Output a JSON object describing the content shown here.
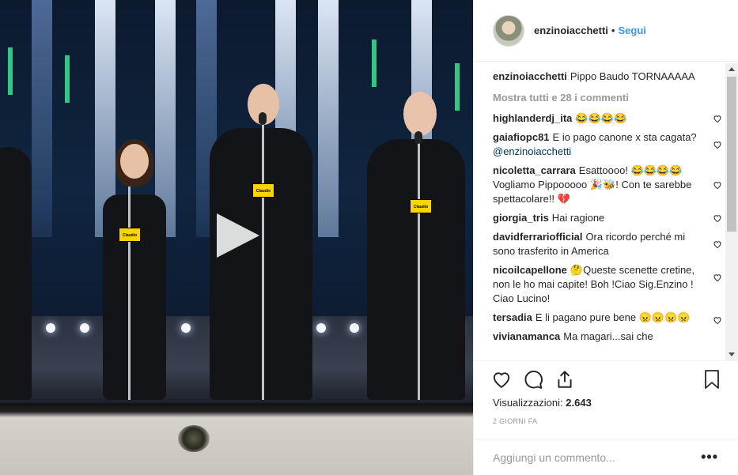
{
  "post": {
    "username": "enzinoiacchetti",
    "separator": "•",
    "follow_label": "Segui"
  },
  "caption": {
    "username": "enzinoiacchetti",
    "text": "Pippo Baudo TORNAAAAA"
  },
  "show_all_comments": "Mostra tutti e 28 i commenti",
  "comments": [
    {
      "user": "highlanderdj_ita",
      "text": "😂😂😂😂"
    },
    {
      "user": "gaiafiopc81",
      "text": "E io pago canone x sta cagata?",
      "mention": "@enzinoiacchetti"
    },
    {
      "user": "nicoletta_carrara",
      "text": "Esattoooo! 😂😂😂😂Vogliamo Pippooooo 🎉🐝! Con te sarebbe spettacolare!! 💔"
    },
    {
      "user": "giorgia_tris",
      "text": "Hai ragione"
    },
    {
      "user": "davidferrariofficial",
      "text": "Ora ricordo perché mi sono trasferito in America"
    },
    {
      "user": "nicoilcapellone",
      "text": "🤔Queste scenette cretine, non le ho mai capite! Boh !Ciao Sig.Enzino ! Ciao Lucino!"
    },
    {
      "user": "tersadia",
      "text": "E li pagano pure bene 😠😠😠😠"
    },
    {
      "user": "vivianamanca",
      "text": "Ma magari...sai che"
    }
  ],
  "views": {
    "label": "Visualizzazioni:",
    "count": "2.643"
  },
  "date": "2 giorni fa",
  "add_comment": {
    "placeholder": "Aggiungi un commento..."
  },
  "more_label": "•••",
  "stand_tag": "Claudio",
  "icons": [
    "heart-icon",
    "comment-icon",
    "share-icon",
    "bookmark-icon",
    "play-icon"
  ],
  "colors": {
    "accent": "#3897f0",
    "text": "#262626",
    "muted": "#999999",
    "mention": "#003569"
  }
}
